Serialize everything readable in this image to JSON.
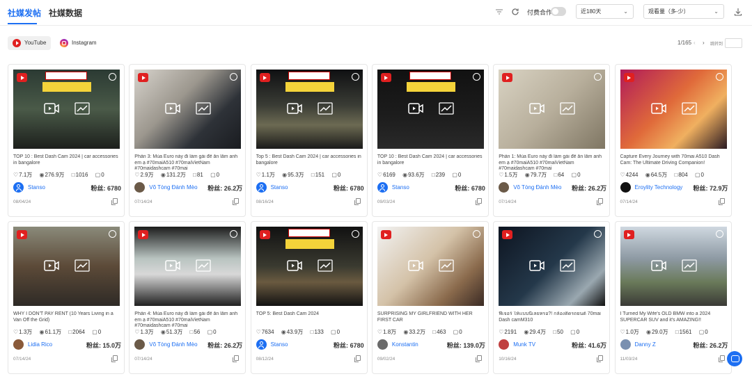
{
  "header": {
    "tabs": [
      {
        "label": "社媒发帖",
        "active": true
      },
      {
        "label": "社媒数据",
        "active": false
      }
    ],
    "toggle_label": "付费合作",
    "toggle_on": false,
    "time_filter": "近180天",
    "sort_filter": "观看量（多-少）"
  },
  "platforms": [
    {
      "label": "YouTube",
      "active": true,
      "icon": "youtube-icon"
    },
    {
      "label": "Instagram",
      "active": false,
      "icon": "instagram-icon"
    }
  ],
  "pagination": {
    "text": "1/165",
    "jump_label": "跳转到"
  },
  "fans_label": "粉丝:",
  "colors": {
    "accent": "#1d6ff2",
    "youtube": "#e02020"
  },
  "cards": [
    {
      "title": "TOP 10 : Best Dash Cam 2024 | car accessories in bangalore",
      "likes": "7.1万",
      "views": "276.9万",
      "comments": "1016",
      "dislikes": "0",
      "author": "Stanso",
      "fans": "6780",
      "date": "08/04/24"
    },
    {
      "title": "Phần 3: Mùa Euro này đi làm gái để ăn lắm anh em ạ #70maiA510 #70maiVietNam #70maidashcam #70mai",
      "likes": "2.9万",
      "views": "131.2万",
      "comments": "81",
      "dislikes": "0",
      "author": "Võ Tòng Đánh Mèo",
      "fans": "26.2万",
      "date": "07/14/24"
    },
    {
      "title": "Top 5 : Best Dash Cam 2024 | car accessories in bangalore",
      "likes": "1.1万",
      "views": "95.3万",
      "comments": "151",
      "dislikes": "0",
      "author": "Stanso",
      "fans": "6780",
      "date": "08/16/24"
    },
    {
      "title": "TOP 10 : Best Dash Cam 2024 | car accessories in bangalore",
      "likes": "6169",
      "views": "93.6万",
      "comments": "239",
      "dislikes": "0",
      "author": "Stanso",
      "fans": "6780",
      "date": "09/03/24"
    },
    {
      "title": "Phần 1: Mùa Euro này đi làm gái để ăn lắm anh em ạ #70maiA510 #70maiVietNam #70maidashcam #70mai",
      "likes": "1.5万",
      "views": "79.7万",
      "comments": "64",
      "dislikes": "0",
      "author": "Võ Tòng Đánh Mèo",
      "fans": "26.2万",
      "date": "07/14/24"
    },
    {
      "title": "Capture Every Journey with 70mai A510 Dash Cam: The Ultimate Driving Companion!",
      "likes": "4244",
      "views": "64.5万",
      "comments": "804",
      "dislikes": "0",
      "author": "Eroylity Technology",
      "fans": "72.9万",
      "date": "07/14/24"
    },
    {
      "title": "WHY I DON'T PAY RENT (10 Years Living in a Van Off the Grid)",
      "likes": "1.3万",
      "views": "61.1万",
      "comments": "2064",
      "dislikes": "0",
      "author": "Lidia Rico",
      "fans": "15.0万",
      "date": "07/14/24"
    },
    {
      "title": "Phần 4: Mùa Euro này đi làm gái để ăn lắm anh em ạ #70maiA510 #70maiVietNam #70maidashcam #70mai",
      "likes": "1.3万",
      "views": "51.3万",
      "comments": "56",
      "dislikes": "0",
      "author": "Võ Tòng Đánh Mèo",
      "fans": "26.2万",
      "date": "07/14/24"
    },
    {
      "title": "TOP 5: Best Dash Cam 2024",
      "likes": "7634",
      "views": "43.9万",
      "comments": "133",
      "dislikes": "0",
      "author": "Stanso",
      "fans": "6780",
      "date": "08/12/24"
    },
    {
      "title": "SURPRISING MY GIRLFRIEND WITH HER FIRST CAR",
      "likes": "1.8万",
      "views": "33.2万",
      "comments": "463",
      "dislikes": "0",
      "author": "Konstantin",
      "fans": "139.0万",
      "date": "09/02/24"
    },
    {
      "title": "ฟีเจอร์ ให้เเบบนี้เลยหรอ?! กล้องติดรถยนต์ 70mai Dash camM310",
      "likes": "2191",
      "views": "29.4万",
      "comments": "50",
      "dislikes": "0",
      "author": "Munk TV",
      "fans": "41.6万",
      "date": "10/16/24"
    },
    {
      "title": "I Turned My Wife's OLD BMW into a 2024 SUPERCAR SUV and it's AMAZING!!",
      "likes": "1.0万",
      "views": "29.0万",
      "comments": "1561",
      "dislikes": "0",
      "author": "Danny Z",
      "fans": "26.2万",
      "date": "11/03/24"
    }
  ]
}
